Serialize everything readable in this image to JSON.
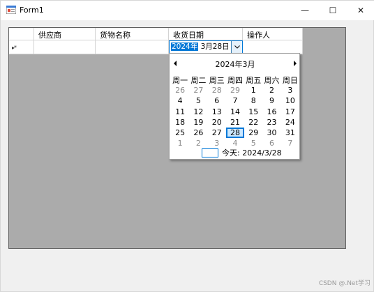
{
  "window": {
    "title": "Form1",
    "minimize_glyph": "—",
    "maximize_glyph": "☐",
    "close_glyph": "✕"
  },
  "grid": {
    "columns": [
      "供应商",
      "货物名称",
      "收货日期",
      "操作人"
    ],
    "new_row_marker": "▸*",
    "editing_value_year": "2024年",
    "editing_value_rest": "3月28日"
  },
  "calendar": {
    "title": "2024年3月",
    "weekdays": [
      "周一",
      "周二",
      "周三",
      "周四",
      "周五",
      "周六",
      "周日"
    ],
    "weeks": [
      [
        "26",
        "27",
        "28",
        "29",
        "1",
        "2",
        "3"
      ],
      [
        "4",
        "5",
        "6",
        "7",
        "8",
        "9",
        "10"
      ],
      [
        "11",
        "12",
        "13",
        "14",
        "15",
        "16",
        "17"
      ],
      [
        "18",
        "19",
        "20",
        "21",
        "22",
        "23",
        "24"
      ],
      [
        "25",
        "26",
        "27",
        "28",
        "29",
        "30",
        "31"
      ],
      [
        "1",
        "2",
        "3",
        "4",
        "5",
        "6",
        "7"
      ]
    ],
    "today_label": "今天: 2024/3/28"
  },
  "watermark": "CSDN @.Net学习",
  "colors": {
    "accent": "#0078d7",
    "grid_bg": "#ababab"
  }
}
